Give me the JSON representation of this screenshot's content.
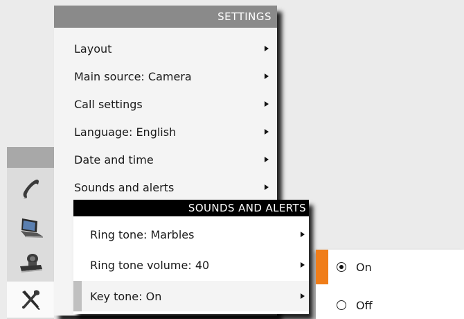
{
  "sidebar": {
    "items": [
      {
        "icon": "phone-handset-icon"
      },
      {
        "icon": "laptop-icon"
      },
      {
        "icon": "camera-icon"
      },
      {
        "icon": "tools-icon",
        "selected": true
      }
    ]
  },
  "settings_menu": {
    "title": "SETTINGS",
    "items": [
      {
        "label": "Layout"
      },
      {
        "label": "Main source: Camera"
      },
      {
        "label": "Call settings"
      },
      {
        "label": "Language: English"
      },
      {
        "label": "Date and time"
      },
      {
        "label": "Sounds and alerts"
      }
    ]
  },
  "sounds_menu": {
    "title": "SOUNDS AND ALERTS",
    "items": [
      {
        "label": "Ring tone: Marbles"
      },
      {
        "label": "Ring tone volume: 40"
      },
      {
        "label": "Key tone: On"
      }
    ]
  },
  "key_tone_options": {
    "items": [
      {
        "label": "On",
        "checked": true
      },
      {
        "label": "Off",
        "checked": false
      }
    ]
  },
  "colors": {
    "accent": "#f07d19",
    "settings_header": "#8a8a8a",
    "submenu_header": "#000000",
    "background": "#ebebeb"
  }
}
